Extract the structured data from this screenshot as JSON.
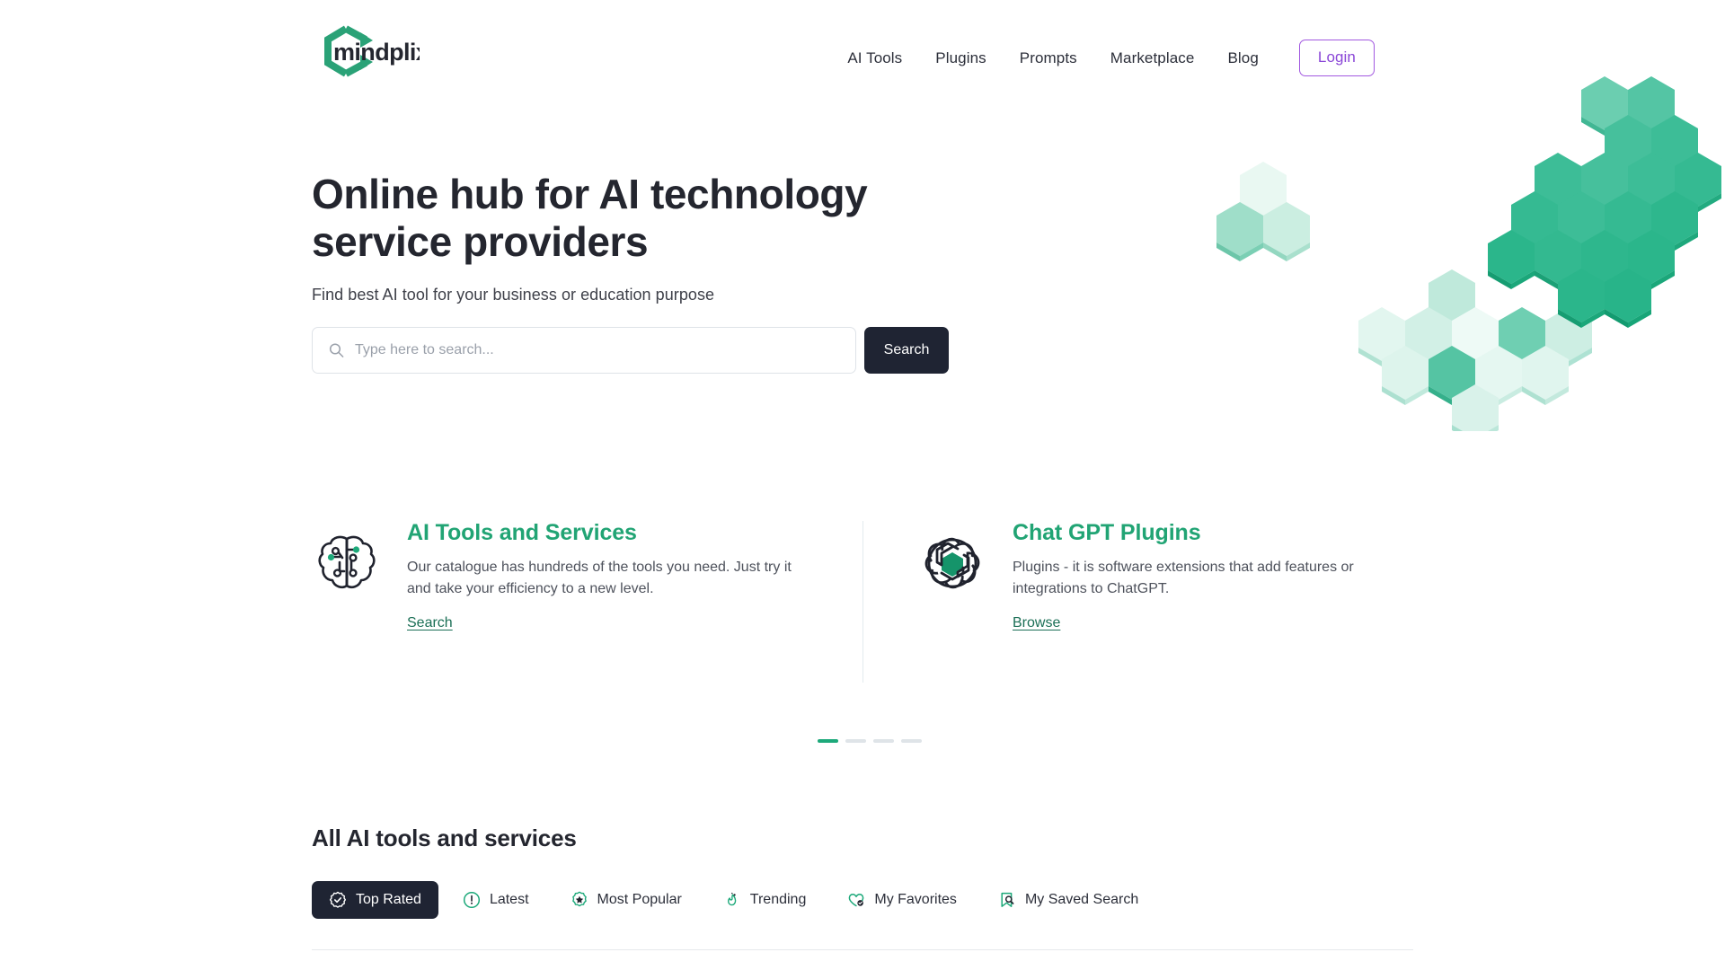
{
  "brand": {
    "name": "mindplix",
    "logo_icon": "hexagon-arrows-logo",
    "accent_green": "#21a474",
    "dark": "#1f2433",
    "purple": "#8a46d7"
  },
  "nav": {
    "items": [
      {
        "label": "AI Tools",
        "icon": ""
      },
      {
        "label": "Plugins",
        "icon": ""
      },
      {
        "label": "Prompts",
        "icon": ""
      },
      {
        "label": "Marketplace",
        "icon": ""
      },
      {
        "label": "Blog",
        "icon": ""
      }
    ],
    "login_label": "Login"
  },
  "hero": {
    "title": "Online hub for AI technology service providers",
    "subtitle": "Find best AI tool for your business or education purpose",
    "search": {
      "placeholder": "Type here to search...",
      "value": "",
      "icon": "search-icon",
      "button_label": "Search"
    }
  },
  "features": [
    {
      "icon": "brain-circuit-icon",
      "title": "AI Tools and Services",
      "description": "Our catalogue has hundreds of the tools you need. Just try it and take your efficiency to a new level.",
      "link_label": "Search"
    },
    {
      "icon": "openai-knot-icon",
      "title": "Chat GPT Plugins",
      "description": "Plugins - it is software extensions that add features or integrations to ChatGPT.",
      "link_label": "Browse"
    }
  ],
  "carousel": {
    "total": 4,
    "active_index": 0
  },
  "section": {
    "title": "All AI tools and services",
    "tabs": [
      {
        "label": "Top Rated",
        "icon": "badge-check-icon",
        "active": true
      },
      {
        "label": "Latest",
        "icon": "exclamation-circle-icon",
        "active": false
      },
      {
        "label": "Most Popular",
        "icon": "star-badge-icon",
        "active": false
      },
      {
        "label": "Trending",
        "icon": "flame-icon",
        "active": false
      },
      {
        "label": "My Favorites",
        "icon": "heart-check-icon",
        "active": false
      },
      {
        "label": "My Saved Search",
        "icon": "bookmark-search-icon",
        "active": false
      }
    ]
  }
}
